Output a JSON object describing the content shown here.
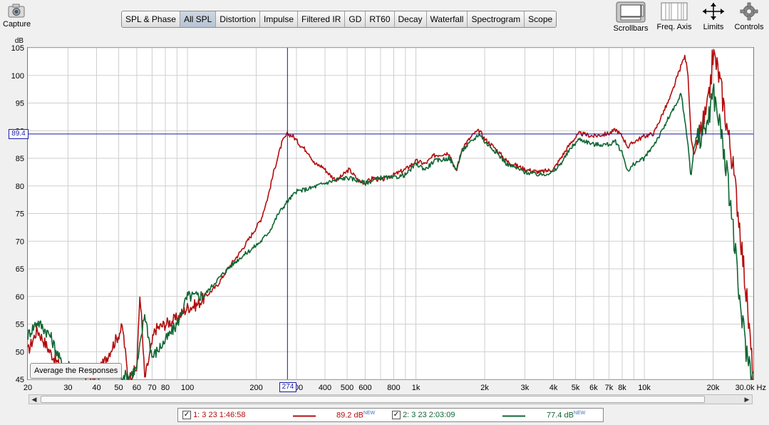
{
  "toolbar": {
    "capture_label": "Capture",
    "scrollbars_label": "Scrollbars",
    "freq_axis_label": "Freq. Axis",
    "limits_label": "Limits",
    "controls_label": "Controls"
  },
  "tabs": [
    {
      "label": "SPL & Phase",
      "active": false
    },
    {
      "label": "All SPL",
      "active": true
    },
    {
      "label": "Distortion",
      "active": false
    },
    {
      "label": "Impulse",
      "active": false
    },
    {
      "label": "Filtered IR",
      "active": false
    },
    {
      "label": "GD",
      "active": false
    },
    {
      "label": "RT60",
      "active": false
    },
    {
      "label": "Decay",
      "active": false
    },
    {
      "label": "Waterfall",
      "active": false
    },
    {
      "label": "Spectrogram",
      "active": false
    },
    {
      "label": "Scope",
      "active": false
    }
  ],
  "average_button_label": "Average the Responses",
  "cursor": {
    "x_label": "274",
    "y_label": "89.4",
    "x": 274,
    "y": 89.4
  },
  "legend": {
    "m1_label": "1: 3 23 1:46:58",
    "m1_value": "89.2 dB",
    "m2_label": "2: 3 23 2:03:09",
    "m2_value": "77.4 dB",
    "new_tag": "NEW"
  },
  "chart_data": {
    "type": "line",
    "ylabel": "dB",
    "xlabel": "",
    "x_scale": "log",
    "xlim": [
      20,
      30000
    ],
    "ylim": [
      45,
      105
    ],
    "grid": true,
    "x_ticks": [
      {
        "v": 20,
        "label": "20"
      },
      {
        "v": 30,
        "label": "30"
      },
      {
        "v": 40,
        "label": "40"
      },
      {
        "v": 50,
        "label": "50"
      },
      {
        "v": 60,
        "label": "60"
      },
      {
        "v": 70,
        "label": "70"
      },
      {
        "v": 80,
        "label": "80"
      },
      {
        "v": 100,
        "label": "100"
      },
      {
        "v": 200,
        "label": "200"
      },
      {
        "v": 300,
        "label": "300"
      },
      {
        "v": 400,
        "label": "400"
      },
      {
        "v": 500,
        "label": "500"
      },
      {
        "v": 600,
        "label": "600"
      },
      {
        "v": 800,
        "label": "800"
      },
      {
        "v": 1000,
        "label": "1k"
      },
      {
        "v": 2000,
        "label": "2k"
      },
      {
        "v": 3000,
        "label": "3k"
      },
      {
        "v": 4000,
        "label": "4k"
      },
      {
        "v": 5000,
        "label": "5k"
      },
      {
        "v": 6000,
        "label": "6k"
      },
      {
        "v": 7000,
        "label": "7k"
      },
      {
        "v": 8000,
        "label": "8k"
      },
      {
        "v": 10000,
        "label": "10k"
      },
      {
        "v": 20000,
        "label": "20k"
      },
      {
        "v": 30000,
        "label": "30.0k Hz"
      }
    ],
    "y_ticks": [
      105,
      100,
      95,
      90,
      85,
      80,
      75,
      70,
      65,
      60,
      55,
      50,
      45
    ],
    "series": [
      {
        "name": "1: 3 23 1:46:58",
        "color": "#b30d0d",
        "points": [
          [
            20,
            50
          ],
          [
            22,
            54
          ],
          [
            25,
            50
          ],
          [
            28,
            47
          ],
          [
            33,
            46
          ],
          [
            40,
            45.5
          ],
          [
            52,
            54.5
          ],
          [
            55,
            45
          ],
          [
            60,
            47
          ],
          [
            62,
            61
          ],
          [
            65,
            45
          ],
          [
            72,
            54
          ],
          [
            80,
            55
          ],
          [
            90,
            56
          ],
          [
            100,
            58
          ],
          [
            110,
            58.5
          ],
          [
            120,
            60
          ],
          [
            135,
            62
          ],
          [
            150,
            65
          ],
          [
            170,
            68
          ],
          [
            190,
            71
          ],
          [
            210,
            74
          ],
          [
            225,
            78
          ],
          [
            240,
            83
          ],
          [
            260,
            88
          ],
          [
            274,
            89.4
          ],
          [
            290,
            89
          ],
          [
            310,
            87.5
          ],
          [
            340,
            86
          ],
          [
            360,
            84
          ],
          [
            390,
            83.5
          ],
          [
            420,
            82
          ],
          [
            450,
            81
          ],
          [
            480,
            82
          ],
          [
            510,
            83
          ],
          [
            560,
            81
          ],
          [
            600,
            80.5
          ],
          [
            650,
            81.5
          ],
          [
            700,
            81
          ],
          [
            750,
            81.5
          ],
          [
            800,
            82
          ],
          [
            900,
            83
          ],
          [
            1000,
            84.5
          ],
          [
            1100,
            84
          ],
          [
            1200,
            85.5
          ],
          [
            1400,
            86
          ],
          [
            1500,
            82.5
          ],
          [
            1600,
            87
          ],
          [
            1800,
            89.5
          ],
          [
            1900,
            90
          ],
          [
            2000,
            88.5
          ],
          [
            2200,
            87
          ],
          [
            2500,
            84.5
          ],
          [
            3000,
            83
          ],
          [
            3500,
            82.5
          ],
          [
            4000,
            83
          ],
          [
            4300,
            85
          ],
          [
            4800,
            88
          ],
          [
            5200,
            89.5
          ],
          [
            6000,
            89
          ],
          [
            7000,
            89.5
          ],
          [
            7500,
            90.2
          ],
          [
            8000,
            89
          ],
          [
            8500,
            87
          ],
          [
            9000,
            88
          ],
          [
            10000,
            89
          ],
          [
            11000,
            89.5
          ],
          [
            12000,
            93
          ],
          [
            13000,
            96
          ],
          [
            14000,
            100
          ],
          [
            15000,
            103.5
          ],
          [
            15500,
            101
          ],
          [
            16000,
            89
          ],
          [
            16500,
            85
          ],
          [
            17000,
            88
          ],
          [
            18000,
            91
          ],
          [
            19000,
            94
          ],
          [
            20000,
            104
          ],
          [
            21000,
            101
          ],
          [
            22000,
            96
          ],
          [
            24000,
            86
          ],
          [
            26000,
            74
          ],
          [
            28000,
            60
          ],
          [
            30000,
            45
          ]
        ]
      },
      {
        "name": "2: 3 23 2:03:09",
        "color": "#0e6633",
        "points": [
          [
            20,
            53
          ],
          [
            22,
            55.5
          ],
          [
            25,
            53
          ],
          [
            28,
            48
          ],
          [
            33,
            47
          ],
          [
            40,
            46
          ],
          [
            50,
            46
          ],
          [
            55,
            45.5
          ],
          [
            60,
            47
          ],
          [
            62,
            51
          ],
          [
            65,
            57
          ],
          [
            70,
            49
          ],
          [
            80,
            52
          ],
          [
            90,
            55
          ],
          [
            100,
            60
          ],
          [
            110,
            60
          ],
          [
            120,
            60.5
          ],
          [
            135,
            63
          ],
          [
            150,
            65
          ],
          [
            170,
            67
          ],
          [
            190,
            68.5
          ],
          [
            210,
            70
          ],
          [
            230,
            72
          ],
          [
            250,
            75
          ],
          [
            274,
            77.2
          ],
          [
            300,
            79
          ],
          [
            340,
            79.5
          ],
          [
            400,
            80.5
          ],
          [
            440,
            81
          ],
          [
            500,
            81.5
          ],
          [
            560,
            81
          ],
          [
            600,
            80.5
          ],
          [
            700,
            81.5
          ],
          [
            800,
            81.5
          ],
          [
            900,
            82
          ],
          [
            1000,
            84
          ],
          [
            1100,
            83
          ],
          [
            1200,
            84.5
          ],
          [
            1400,
            85
          ],
          [
            1500,
            83
          ],
          [
            1600,
            86.5
          ],
          [
            1800,
            88.5
          ],
          [
            1900,
            89.5
          ],
          [
            2000,
            88
          ],
          [
            2200,
            86.5
          ],
          [
            2500,
            84
          ],
          [
            3000,
            82.5
          ],
          [
            3500,
            82
          ],
          [
            4000,
            82.5
          ],
          [
            4300,
            84
          ],
          [
            4800,
            87
          ],
          [
            5200,
            88.5
          ],
          [
            6000,
            87.5
          ],
          [
            7000,
            87.5
          ],
          [
            7500,
            88
          ],
          [
            8000,
            86
          ],
          [
            8500,
            82.5
          ],
          [
            9000,
            84
          ],
          [
            10000,
            85
          ],
          [
            11000,
            87.5
          ],
          [
            12000,
            90
          ],
          [
            13000,
            93
          ],
          [
            14000,
            95
          ],
          [
            14500,
            97
          ],
          [
            15000,
            92
          ],
          [
            15500,
            88
          ],
          [
            16000,
            81.5
          ],
          [
            16500,
            87
          ],
          [
            17000,
            89
          ],
          [
            18000,
            89.5
          ],
          [
            19000,
            92
          ],
          [
            20000,
            97
          ],
          [
            21000,
            93
          ],
          [
            22000,
            88
          ],
          [
            24000,
            76
          ],
          [
            26000,
            60
          ],
          [
            28000,
            50
          ],
          [
            30000,
            45
          ]
        ]
      }
    ]
  }
}
